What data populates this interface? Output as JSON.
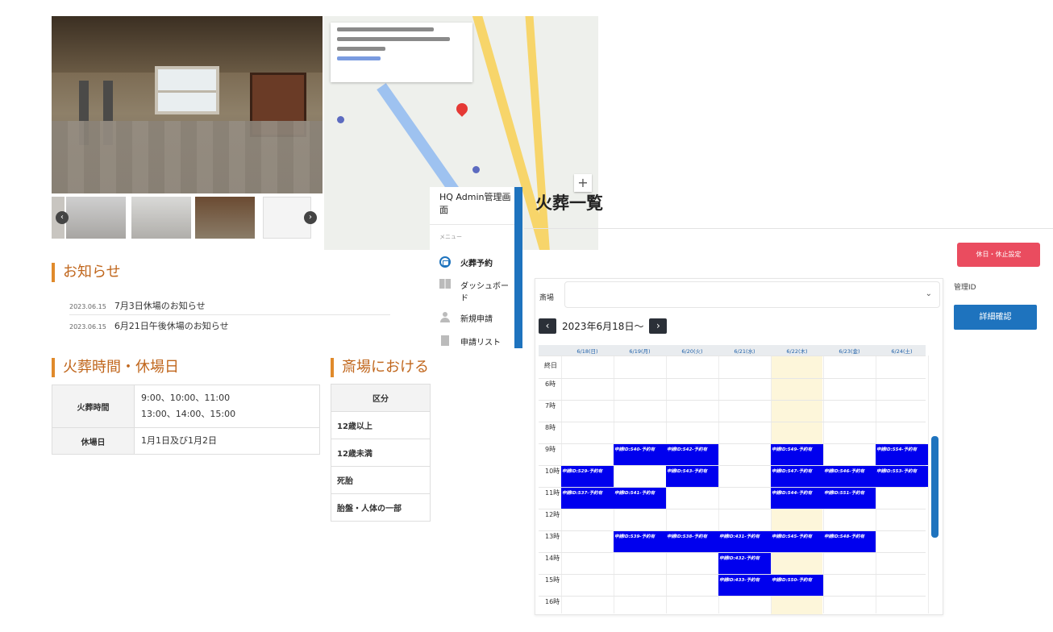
{
  "site": {
    "notices_title": "お知らせ",
    "notices": [
      {
        "date": "2023.06.15",
        "title": "7月3日休場のお知らせ"
      },
      {
        "date": "2023.06.15",
        "title": "6月21日午後休場のお知らせ"
      }
    ],
    "hours_title": "火葬時間・休場日",
    "hours_table": [
      {
        "label": "火葬時間",
        "lines": [
          "9:00、10:00、11:00",
          "13:00、14:00、15:00"
        ]
      },
      {
        "label": "休場日",
        "lines": [
          "1月1日及び1月2日"
        ]
      }
    ],
    "fees_title": "斎場における",
    "fees_table": {
      "header": "区分",
      "rows": [
        "12歳以上",
        "12歳未満",
        "死胎",
        "胎盤・人体の一部"
      ]
    }
  },
  "sidebar": {
    "brand": "HQ Admin管理画面",
    "menu_label": "メニュー",
    "items": [
      {
        "label": "火葬予約",
        "icon": "calendar-icon",
        "active": true
      },
      {
        "label": "ダッシュボード",
        "icon": "dashboard-icon",
        "active": false
      },
      {
        "label": "新規申請",
        "icon": "user-add-icon",
        "active": false
      },
      {
        "label": "申請リスト",
        "icon": "document-icon",
        "active": false
      }
    ],
    "accent_color": "#1e73be"
  },
  "main": {
    "title": "火葬一覧",
    "holiday_button": "休日・休止設定",
    "management_id_label": "管理ID",
    "detail_button": "詳細確認",
    "venue_label": "斎場",
    "venue_value": "",
    "week_label": "2023年6月18日〜",
    "prev_icon": "chevron-left-icon",
    "next_icon": "chevron-right-icon"
  },
  "calendar": {
    "days": [
      "6/18(日)",
      "6/19(月)",
      "6/20(火)",
      "6/21(水)",
      "6/22(木)",
      "6/23(金)",
      "6/24(土)"
    ],
    "today_index": 4,
    "allday_label": "終日",
    "hours": [
      "6時",
      "7時",
      "8時",
      "9時",
      "10時",
      "11時",
      "12時",
      "13時",
      "14時",
      "15時",
      "16時"
    ],
    "event_color": "#0000ee",
    "events": [
      {
        "day": 1,
        "hour": 9,
        "label": "申請ID:540-予約有"
      },
      {
        "day": 2,
        "hour": 9,
        "label": "申請ID:542-予約有"
      },
      {
        "day": 4,
        "hour": 9,
        "label": "申請ID:549-予約有"
      },
      {
        "day": 6,
        "hour": 9,
        "label": "申請ID:554-予約有"
      },
      {
        "day": 0,
        "hour": 10,
        "label": "申請ID:529-予約有"
      },
      {
        "day": 2,
        "hour": 10,
        "label": "申請ID:543-予約有"
      },
      {
        "day": 4,
        "hour": 10,
        "label": "申請ID:547-予約有"
      },
      {
        "day": 5,
        "hour": 10,
        "label": "申請ID:546-予約有"
      },
      {
        "day": 6,
        "hour": 10,
        "label": "申請ID:553-予約有"
      },
      {
        "day": 0,
        "hour": 11,
        "label": "申請ID:537-予約有"
      },
      {
        "day": 1,
        "hour": 11,
        "label": "申請ID:541-予約有"
      },
      {
        "day": 4,
        "hour": 11,
        "label": "申請ID:544-予約有"
      },
      {
        "day": 5,
        "hour": 11,
        "label": "申請ID:551-予約有"
      },
      {
        "day": 1,
        "hour": 13,
        "label": "申請ID:539-予約有"
      },
      {
        "day": 2,
        "hour": 13,
        "label": "申請ID:538-予約有"
      },
      {
        "day": 3,
        "hour": 13,
        "label": "申請ID:431-予約有"
      },
      {
        "day": 4,
        "hour": 13,
        "label": "申請ID:545-予約有"
      },
      {
        "day": 5,
        "hour": 13,
        "label": "申請ID:548-予約有"
      },
      {
        "day": 3,
        "hour": 14,
        "label": "申請ID:432-予約有"
      },
      {
        "day": 3,
        "hour": 15,
        "label": "申請ID:433-予約有"
      },
      {
        "day": 4,
        "hour": 15,
        "label": "申請ID:550-予約有"
      }
    ]
  }
}
